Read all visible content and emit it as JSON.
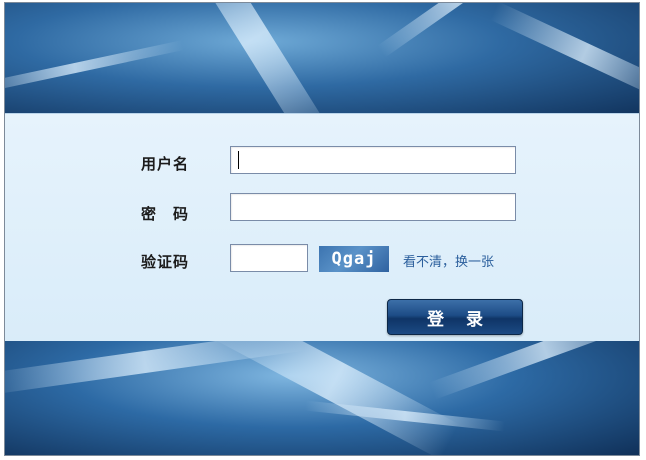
{
  "form": {
    "username_label": "用户名",
    "username_value": "",
    "password_label": "密　码",
    "password_value": "",
    "captcha_label": "验证码",
    "captcha_value": "",
    "captcha_text": "Qgaj",
    "refresh_link": "看不清，换一张",
    "login_button": "登 录"
  },
  "colors": {
    "banner_dark": "#12355f",
    "banner_light": "#6ea9d6",
    "form_background": "#dff0fb",
    "link": "#2a5e9c",
    "button": "#1d4c86"
  }
}
